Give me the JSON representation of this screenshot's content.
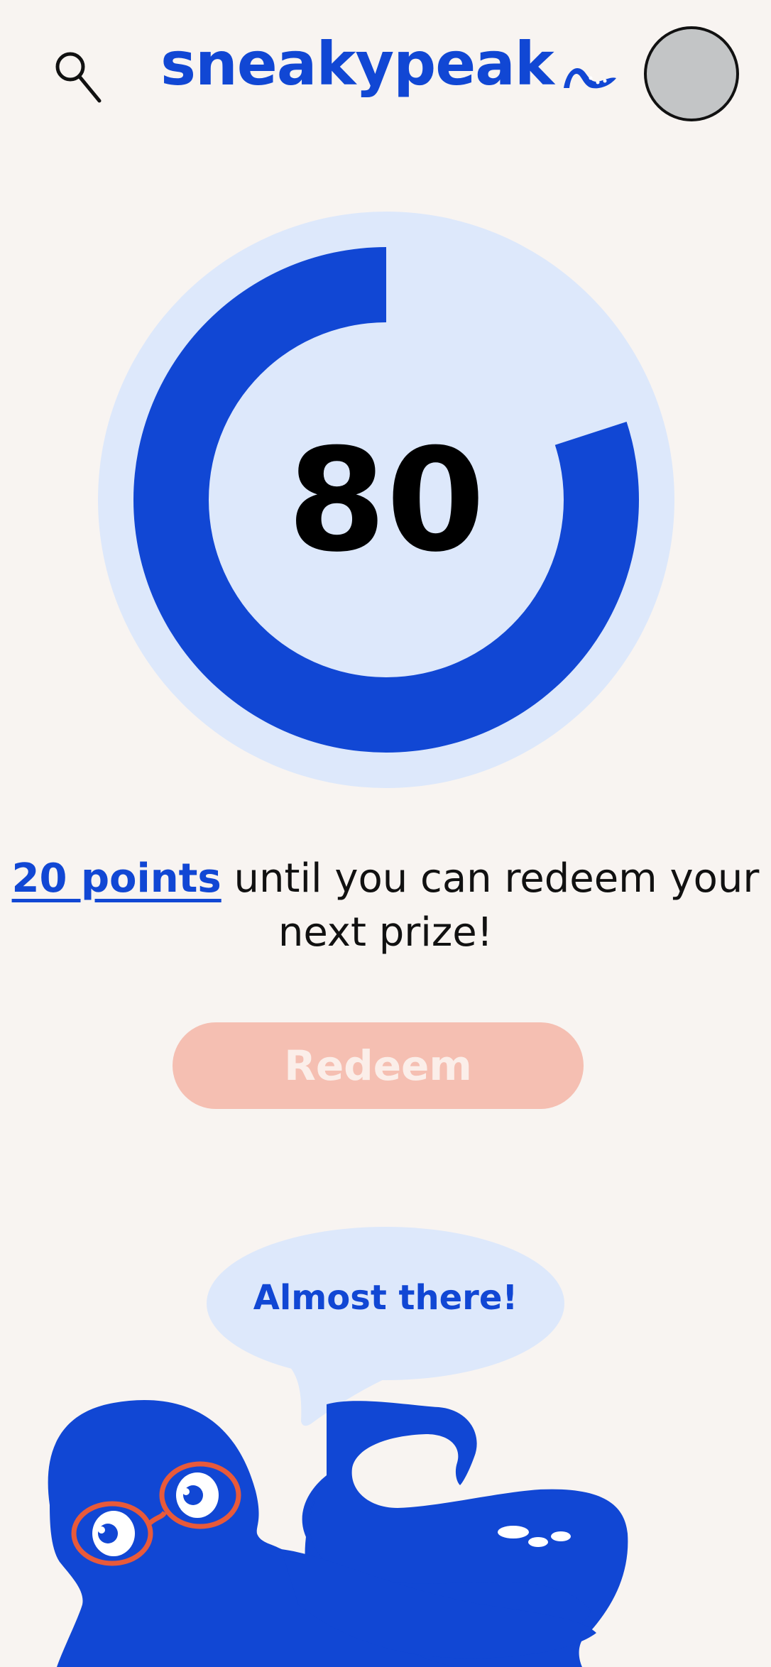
{
  "header": {
    "search_icon": "search-icon",
    "brand": "sneakypeak",
    "avatar_icon": "avatar"
  },
  "colors": {
    "accent": "#1147d4",
    "gauge_track": "#dde8fb",
    "page_bg": "#f8f4f1",
    "button_bg": "#f5bfb2",
    "glasses": "#e85a3a"
  },
  "score": {
    "value": "80",
    "progress_fraction": 0.8
  },
  "message": {
    "points": "20 points",
    "rest": " until you can redeem your next prize!"
  },
  "redeem": {
    "label": "Redeem"
  },
  "mascot": {
    "speech": "Almost there!"
  }
}
